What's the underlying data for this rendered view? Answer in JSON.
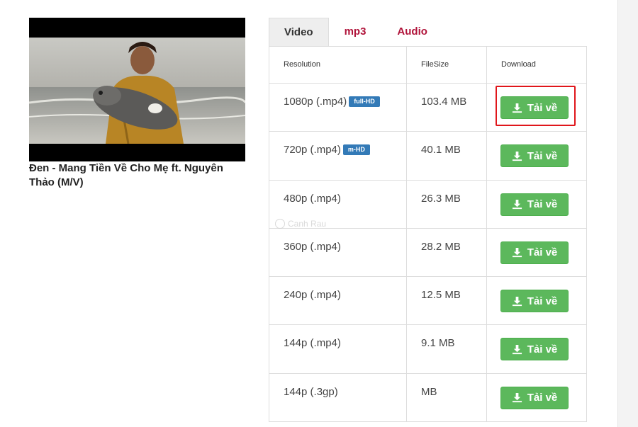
{
  "video": {
    "title": "Đen - Mang Tiền Về Cho Mẹ ft. Nguyên Thảo (M/V)"
  },
  "tabs": [
    {
      "label": "Video",
      "active": true
    },
    {
      "label": "mp3",
      "active": false
    },
    {
      "label": "Audio",
      "active": false
    }
  ],
  "table": {
    "headers": {
      "resolution": "Resolution",
      "filesize": "FileSize",
      "download": "Download"
    },
    "rows": [
      {
        "resolution": "1080p (.mp4)",
        "badge": "full-HD",
        "filesize": "103.4 MB",
        "button": "Tải về"
      },
      {
        "resolution": "720p (.mp4)",
        "badge": "m-HD",
        "filesize": "40.1 MB",
        "button": "Tải về"
      },
      {
        "resolution": "480p (.mp4)",
        "badge": "",
        "filesize": "26.3 MB",
        "button": "Tải về"
      },
      {
        "resolution": "360p (.mp4)",
        "badge": "",
        "filesize": "28.2 MB",
        "button": "Tải về"
      },
      {
        "resolution": "240p (.mp4)",
        "badge": "",
        "filesize": "12.5 MB",
        "button": "Tải về"
      },
      {
        "resolution": "144p (.mp4)",
        "badge": "",
        "filesize": "9.1 MB",
        "button": "Tải về"
      },
      {
        "resolution": "144p (.3gp)",
        "badge": "",
        "filesize": "MB",
        "button": "Tải về"
      }
    ]
  },
  "watermark": {
    "text": "Canh Rau"
  },
  "colors": {
    "accent_tab": "#b0133a",
    "button_green": "#5cb85c",
    "badge_blue": "#337ab7",
    "highlight_red": "#e0161b"
  },
  "icons": {
    "download": "download-icon"
  }
}
